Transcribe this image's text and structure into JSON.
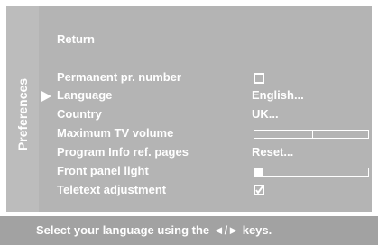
{
  "menu": {
    "section_title": "Preferences",
    "return_label": "Return",
    "items": [
      {
        "label": "Permanent pr. number",
        "value": "",
        "control": "checkbox",
        "checked": false
      },
      {
        "label": "Language",
        "value": "English...",
        "control": "text",
        "selected": true
      },
      {
        "label": "Country",
        "value": "UK...",
        "control": "text"
      },
      {
        "label": "Maximum TV volume",
        "value": "",
        "control": "slider-split"
      },
      {
        "label": "Program Info ref. pages",
        "value": "Reset...",
        "control": "text"
      },
      {
        "label": "Front panel light",
        "value": "",
        "control": "slider",
        "level": 0.08
      },
      {
        "label": "Teletext adjustment",
        "value": "",
        "control": "checkbox",
        "checked": true
      }
    ]
  },
  "status": {
    "text": "Select your language using the ◄/► keys."
  },
  "icons": {
    "cursor": "play-arrow-icon",
    "checkbox": "checkbox-icon"
  },
  "colors": {
    "panel": "#b4b4b4",
    "status_bar": "#a2a2a2",
    "text": "#ffffff"
  }
}
